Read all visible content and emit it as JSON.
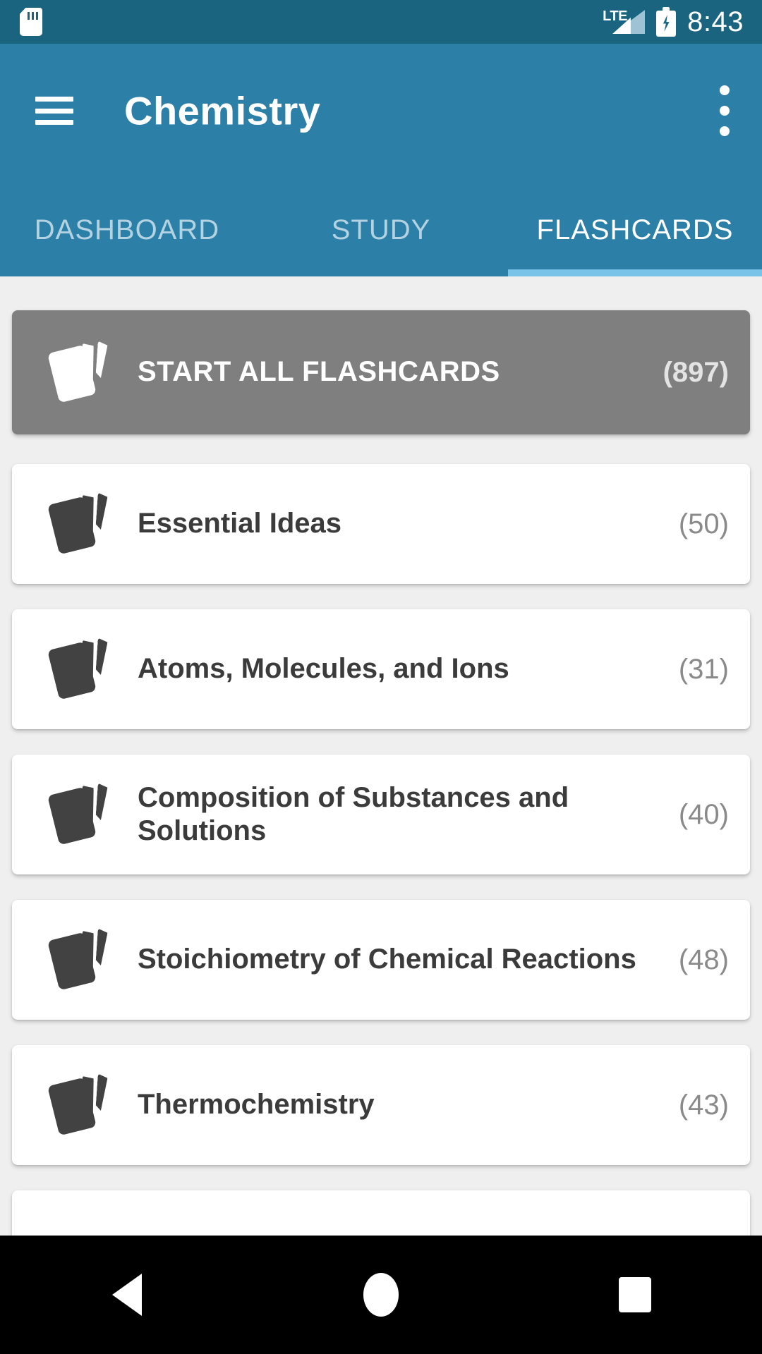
{
  "status_bar": {
    "sd_card_icon": "sd-card-icon",
    "network_label": "LTE",
    "signal_icon": "signal-icon",
    "battery_icon": "battery-charging-icon",
    "time": "8:43"
  },
  "app_bar": {
    "menu_icon": "hamburger-menu-icon",
    "title": "Chemistry",
    "overflow_icon": "overflow-menu-icon"
  },
  "tabs": [
    {
      "label": "DASHBOARD",
      "active": false
    },
    {
      "label": "STUDY",
      "active": false
    },
    {
      "label": "FLASHCARDS",
      "active": true
    }
  ],
  "colors": {
    "status_bar": "#1b6480",
    "app_bar": "#2c80a8",
    "tab_indicator": "#79c3e8",
    "page_background": "#efefef",
    "primary_card": "#7f7f7f",
    "card": "#ffffff",
    "card_text": "#3b3b3b",
    "count_text": "#8a8a8a",
    "nav_bar": "#000000"
  },
  "flashcards": {
    "start_all": {
      "icon": "flashcard-stack-icon",
      "label": "START ALL FLASHCARDS",
      "count": "(897)"
    },
    "chapters": [
      {
        "icon": "flashcard-stack-icon",
        "label": "Essential Ideas",
        "count": "(50)"
      },
      {
        "icon": "flashcard-stack-icon",
        "label": "Atoms, Molecules, and Ions",
        "count": "(31)"
      },
      {
        "icon": "flashcard-stack-icon",
        "label": "Composition of Substances and Solutions",
        "count": "(40)"
      },
      {
        "icon": "flashcard-stack-icon",
        "label": "Stoichiometry of Chemical Reactions",
        "count": "(48)"
      },
      {
        "icon": "flashcard-stack-icon",
        "label": "Thermochemistry",
        "count": "(43)"
      }
    ]
  },
  "nav_bar": {
    "back_icon": "back-triangle-icon",
    "home_icon": "home-circle-icon",
    "recents_icon": "recents-square-icon"
  }
}
